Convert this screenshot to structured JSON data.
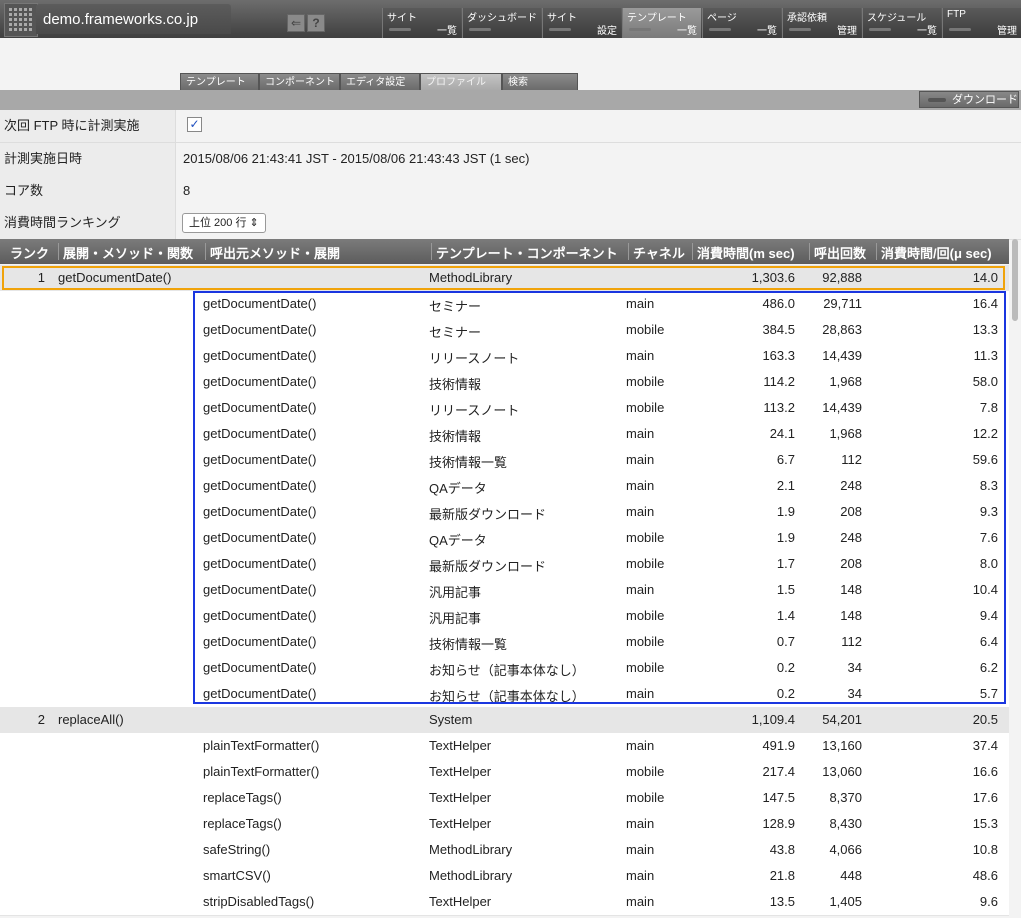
{
  "site_name": "demo.frameworks.co.jp",
  "nav": [
    {
      "top": "サイト",
      "bottom": "一覧"
    },
    {
      "top": "ダッシュボード",
      "bottom": ""
    },
    {
      "top": "サイト",
      "bottom": "設定"
    },
    {
      "top": "テンプレート",
      "bottom": "一覧",
      "active": true
    },
    {
      "top": "ページ",
      "bottom": "一覧"
    },
    {
      "top": "承認依頼",
      "bottom": "管理"
    },
    {
      "top": "スケジュール",
      "bottom": "一覧"
    },
    {
      "top": "FTP",
      "bottom": "管理"
    }
  ],
  "tabs": [
    "テンプレート",
    "コンポーネント",
    "エディタ設定",
    "プロファイル",
    "検索"
  ],
  "active_tab": "プロファイル",
  "download_label": "ダウンロード",
  "settings": {
    "next_ftp_label": "次回 FTP 時に計測実施",
    "next_ftp_checked": true,
    "measured_label": "計測実施日時",
    "measured_value": "2015/08/06 21:43:41 JST - 2015/08/06 21:43:43 JST (1 sec)",
    "cores_label": "コア数",
    "cores_value": "8",
    "ranking_label": "消費時間ランキング",
    "ranking_value": "上位 200 行"
  },
  "columns": [
    "ランク",
    "展開・メソッド・関数",
    "呼出元メソッド・展開",
    "テンプレート・コンポーネント",
    "チャネル",
    "消費時間(m sec)",
    "呼出回数",
    "消費時間/回(μ sec)"
  ],
  "rows": [
    {
      "rank": "1",
      "method": "getDocumentDate()",
      "caller": "",
      "tpl": "MethodLibrary",
      "ch": "",
      "time": "1,303.6",
      "calls": "92,888",
      "per": "14.0",
      "main": true
    },
    {
      "rank": "",
      "method": "",
      "caller": "getDocumentDate()",
      "tpl": "セミナー",
      "ch": "main",
      "time": "486.0",
      "calls": "29,711",
      "per": "16.4"
    },
    {
      "rank": "",
      "method": "",
      "caller": "getDocumentDate()",
      "tpl": "セミナー",
      "ch": "mobile",
      "time": "384.5",
      "calls": "28,863",
      "per": "13.3"
    },
    {
      "rank": "",
      "method": "",
      "caller": "getDocumentDate()",
      "tpl": "リリースノート",
      "ch": "main",
      "time": "163.3",
      "calls": "14,439",
      "per": "11.3"
    },
    {
      "rank": "",
      "method": "",
      "caller": "getDocumentDate()",
      "tpl": "技術情報",
      "ch": "mobile",
      "time": "114.2",
      "calls": "1,968",
      "per": "58.0"
    },
    {
      "rank": "",
      "method": "",
      "caller": "getDocumentDate()",
      "tpl": "リリースノート",
      "ch": "mobile",
      "time": "113.2",
      "calls": "14,439",
      "per": "7.8"
    },
    {
      "rank": "",
      "method": "",
      "caller": "getDocumentDate()",
      "tpl": "技術情報",
      "ch": "main",
      "time": "24.1",
      "calls": "1,968",
      "per": "12.2"
    },
    {
      "rank": "",
      "method": "",
      "caller": "getDocumentDate()",
      "tpl": "技術情報一覧",
      "ch": "main",
      "time": "6.7",
      "calls": "112",
      "per": "59.6"
    },
    {
      "rank": "",
      "method": "",
      "caller": "getDocumentDate()",
      "tpl": "QAデータ",
      "ch": "main",
      "time": "2.1",
      "calls": "248",
      "per": "8.3"
    },
    {
      "rank": "",
      "method": "",
      "caller": "getDocumentDate()",
      "tpl": "最新版ダウンロード",
      "ch": "main",
      "time": "1.9",
      "calls": "208",
      "per": "9.3"
    },
    {
      "rank": "",
      "method": "",
      "caller": "getDocumentDate()",
      "tpl": "QAデータ",
      "ch": "mobile",
      "time": "1.9",
      "calls": "248",
      "per": "7.6"
    },
    {
      "rank": "",
      "method": "",
      "caller": "getDocumentDate()",
      "tpl": "最新版ダウンロード",
      "ch": "mobile",
      "time": "1.7",
      "calls": "208",
      "per": "8.0"
    },
    {
      "rank": "",
      "method": "",
      "caller": "getDocumentDate()",
      "tpl": "汎用記事",
      "ch": "main",
      "time": "1.5",
      "calls": "148",
      "per": "10.4"
    },
    {
      "rank": "",
      "method": "",
      "caller": "getDocumentDate()",
      "tpl": "汎用記事",
      "ch": "mobile",
      "time": "1.4",
      "calls": "148",
      "per": "9.4"
    },
    {
      "rank": "",
      "method": "",
      "caller": "getDocumentDate()",
      "tpl": "技術情報一覧",
      "ch": "mobile",
      "time": "0.7",
      "calls": "112",
      "per": "6.4"
    },
    {
      "rank": "",
      "method": "",
      "caller": "getDocumentDate()",
      "tpl": "お知らせ（記事本体なし）",
      "ch": "mobile",
      "time": "0.2",
      "calls": "34",
      "per": "6.2"
    },
    {
      "rank": "",
      "method": "",
      "caller": "getDocumentDate()",
      "tpl": "お知らせ（記事本体なし）",
      "ch": "main",
      "time": "0.2",
      "calls": "34",
      "per": "5.7"
    },
    {
      "rank": "2",
      "method": "replaceAll()",
      "caller": "",
      "tpl": "System",
      "ch": "",
      "time": "1,109.4",
      "calls": "54,201",
      "per": "20.5",
      "main": true
    },
    {
      "rank": "",
      "method": "",
      "caller": "plainTextFormatter()",
      "tpl": "TextHelper",
      "ch": "main",
      "time": "491.9",
      "calls": "13,160",
      "per": "37.4"
    },
    {
      "rank": "",
      "method": "",
      "caller": "plainTextFormatter()",
      "tpl": "TextHelper",
      "ch": "mobile",
      "time": "217.4",
      "calls": "13,060",
      "per": "16.6"
    },
    {
      "rank": "",
      "method": "",
      "caller": "replaceTags()",
      "tpl": "TextHelper",
      "ch": "mobile",
      "time": "147.5",
      "calls": "8,370",
      "per": "17.6"
    },
    {
      "rank": "",
      "method": "",
      "caller": "replaceTags()",
      "tpl": "TextHelper",
      "ch": "main",
      "time": "128.9",
      "calls": "8,430",
      "per": "15.3"
    },
    {
      "rank": "",
      "method": "",
      "caller": "safeString()",
      "tpl": "MethodLibrary",
      "ch": "main",
      "time": "43.8",
      "calls": "4,066",
      "per": "10.8"
    },
    {
      "rank": "",
      "method": "",
      "caller": "smartCSV()",
      "tpl": "MethodLibrary",
      "ch": "main",
      "time": "21.8",
      "calls": "448",
      "per": "48.6"
    },
    {
      "rank": "",
      "method": "",
      "caller": "stripDisabledTags()",
      "tpl": "TextHelper",
      "ch": "main",
      "time": "13.5",
      "calls": "1,405",
      "per": "9.6"
    }
  ],
  "colors": {
    "highlight_orange": "#f0a30a",
    "highlight_blue": "#1a36e0"
  }
}
